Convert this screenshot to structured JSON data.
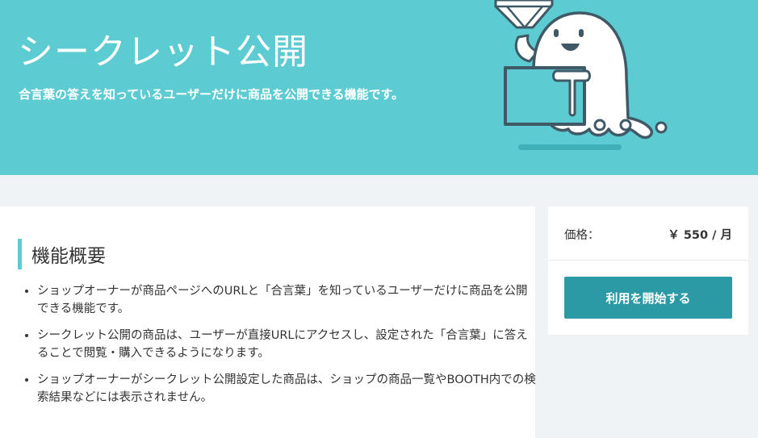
{
  "hero": {
    "title": "シークレット公開",
    "subtitle": "合言葉の答えを知っているユーザーだけに商品を公開できる機能です。",
    "illustration_icon": "ghost-with-diamond-and-box-icon",
    "background_color": "#5ccbd2"
  },
  "overview": {
    "heading": "機能概要",
    "items": [
      "ショップオーナーが商品ページへのURLと「合言葉」を知っているユーザーだけに商品を公開できる機能です。",
      "シークレット公開の商品は、ユーザーが直接URLにアクセスし、設定された「合言葉」に答えることで閲覧・購入できるようになります。",
      "ショップオーナーがシークレット公開設定した商品は、ショップの商品一覧やBOOTH内での検索結果などには表示されません。"
    ]
  },
  "pricing": {
    "label": "価格：",
    "value": "￥ 550 / 月",
    "button_label": "利用を開始する",
    "button_color": "#2c9aa5"
  }
}
